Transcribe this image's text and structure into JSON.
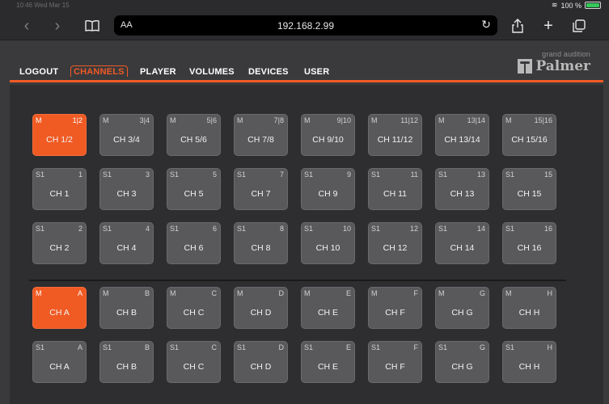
{
  "status_bar": {
    "carrier": "10:46  Wed Mar 15",
    "battery": "100 %"
  },
  "browser": {
    "text_size_label": "AA",
    "url": "192.168.2.99"
  },
  "nav": {
    "items": [
      {
        "label": "LOGOUT",
        "active": false
      },
      {
        "label": "CHANNELS",
        "active": true
      },
      {
        "label": "PLAYER",
        "active": false
      },
      {
        "label": "VOLUMES",
        "active": false
      },
      {
        "label": "DEVICES",
        "active": false
      },
      {
        "label": "USER",
        "active": false
      }
    ]
  },
  "brand": {
    "tagline": "grand audition",
    "name": "Palmer"
  },
  "rows": [
    [
      {
        "tl": "M",
        "tr": "1|2",
        "label": "CH 1/2",
        "active": true
      },
      {
        "tl": "M",
        "tr": "3|4",
        "label": "CH 3/4"
      },
      {
        "tl": "M",
        "tr": "5|6",
        "label": "CH 5/6"
      },
      {
        "tl": "M",
        "tr": "7|8",
        "label": "CH 7/8"
      },
      {
        "tl": "M",
        "tr": "9|10",
        "label": "CH 9/10"
      },
      {
        "tl": "M",
        "tr": "11|12",
        "label": "CH 11/12"
      },
      {
        "tl": "M",
        "tr": "13|14",
        "label": "CH 13/14"
      },
      {
        "tl": "M",
        "tr": "15|16",
        "label": "CH 15/16"
      }
    ],
    [
      {
        "tl": "S1",
        "tr": "1",
        "label": "CH 1"
      },
      {
        "tl": "S1",
        "tr": "3",
        "label": "CH 3"
      },
      {
        "tl": "S1",
        "tr": "5",
        "label": "CH 5"
      },
      {
        "tl": "S1",
        "tr": "7",
        "label": "CH 7"
      },
      {
        "tl": "S1",
        "tr": "9",
        "label": "CH 9"
      },
      {
        "tl": "S1",
        "tr": "11",
        "label": "CH 11"
      },
      {
        "tl": "S1",
        "tr": "13",
        "label": "CH 13"
      },
      {
        "tl": "S1",
        "tr": "15",
        "label": "CH 15"
      }
    ],
    [
      {
        "tl": "S1",
        "tr": "2",
        "label": "CH 2"
      },
      {
        "tl": "S1",
        "tr": "4",
        "label": "CH 4"
      },
      {
        "tl": "S1",
        "tr": "6",
        "label": "CH 6"
      },
      {
        "tl": "S1",
        "tr": "8",
        "label": "CH 8"
      },
      {
        "tl": "S1",
        "tr": "10",
        "label": "CH 10"
      },
      {
        "tl": "S1",
        "tr": "12",
        "label": "CH 12"
      },
      {
        "tl": "S1",
        "tr": "14",
        "label": "CH 14"
      },
      {
        "tl": "S1",
        "tr": "16",
        "label": "CH 16"
      }
    ],
    [
      {
        "tl": "M",
        "tr": "A",
        "label": "CH A",
        "active": true
      },
      {
        "tl": "M",
        "tr": "B",
        "label": "CH B"
      },
      {
        "tl": "M",
        "tr": "C",
        "label": "CH C"
      },
      {
        "tl": "M",
        "tr": "D",
        "label": "CH D"
      },
      {
        "tl": "M",
        "tr": "E",
        "label": "CH E"
      },
      {
        "tl": "M",
        "tr": "F",
        "label": "CH F"
      },
      {
        "tl": "M",
        "tr": "G",
        "label": "CH G"
      },
      {
        "tl": "M",
        "tr": "H",
        "label": "CH H"
      }
    ],
    [
      {
        "tl": "S1",
        "tr": "A",
        "label": "CH A"
      },
      {
        "tl": "S1",
        "tr": "B",
        "label": "CH B"
      },
      {
        "tl": "S1",
        "tr": "C",
        "label": "CH C"
      },
      {
        "tl": "S1",
        "tr": "D",
        "label": "CH D"
      },
      {
        "tl": "S1",
        "tr": "E",
        "label": "CH E"
      },
      {
        "tl": "S1",
        "tr": "F",
        "label": "CH F"
      },
      {
        "tl": "S1",
        "tr": "G",
        "label": "CH G"
      },
      {
        "tl": "S1",
        "tr": "H",
        "label": "CH H"
      }
    ]
  ],
  "colors": {
    "accent": "#f05a23",
    "button": "#59595c",
    "panel": "#2e2e30",
    "page": "#3a3a3c"
  }
}
